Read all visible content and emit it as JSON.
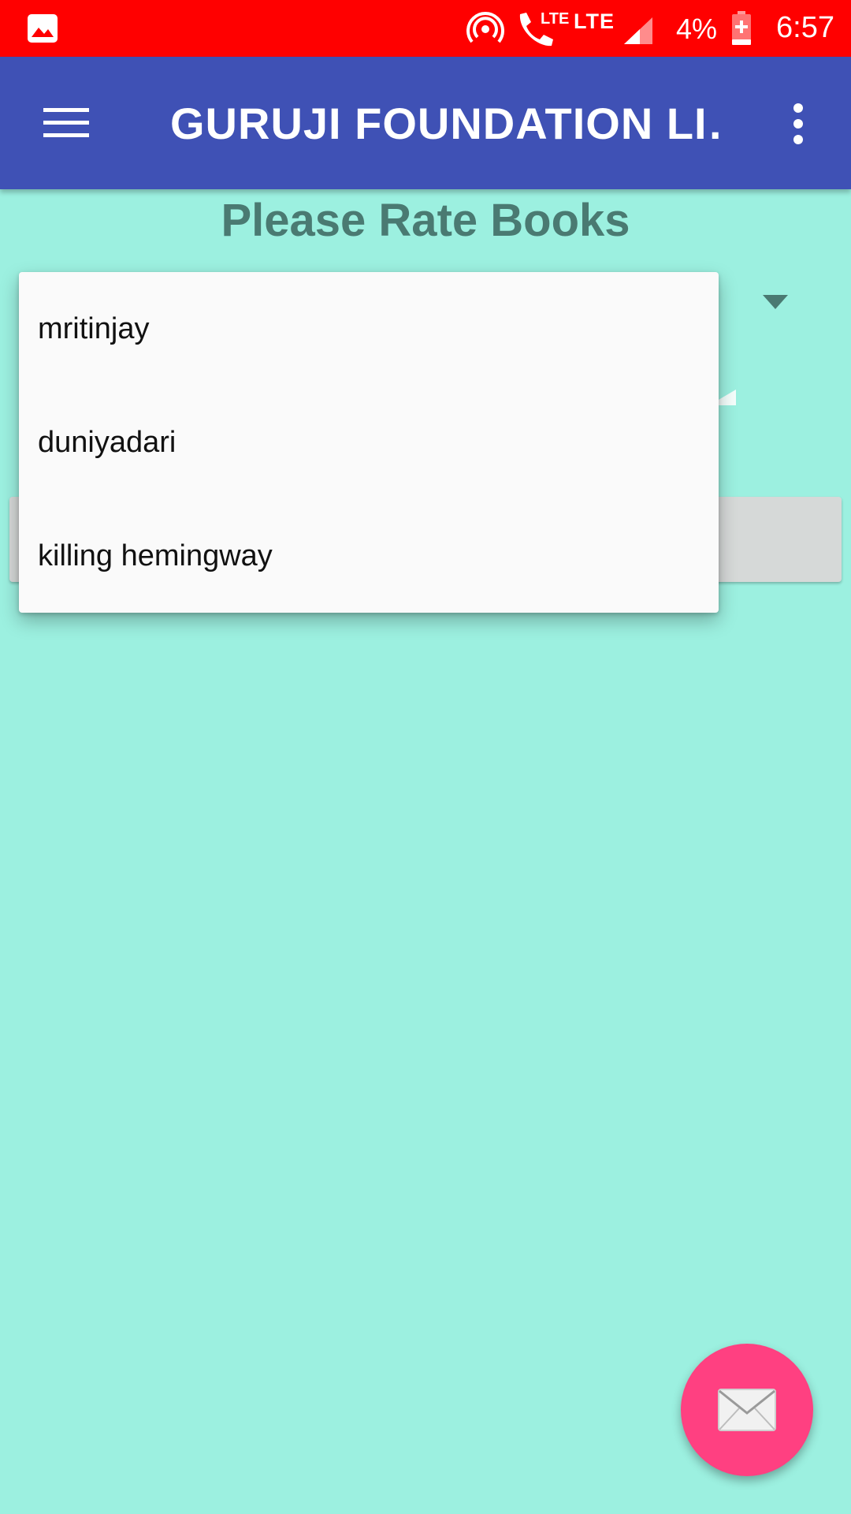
{
  "status_bar": {
    "call_lte": "LTE",
    "network": "LTE",
    "battery": "4%",
    "time": "6:57",
    "background_color": "#ff0000",
    "icons": [
      "gallery-icon",
      "hotspot-icon",
      "call-icon",
      "signal-icon",
      "battery-charging-icon"
    ]
  },
  "app_bar": {
    "title": "GURUJI FOUNDATION LI…",
    "background_color": "#3f51b5",
    "icons": [
      "hamburger-menu-icon",
      "overflow-menu-icon"
    ]
  },
  "main": {
    "heading": "Please Rate Books",
    "background_color": "#9cf0e0",
    "spinner_icon": "dropdown-arrow-icon"
  },
  "dropdown": {
    "options": [
      "mritinjay",
      "duniyadari",
      "killing hemingway"
    ]
  },
  "fab": {
    "icon": "envelope-icon",
    "color": "#ff4081"
  }
}
